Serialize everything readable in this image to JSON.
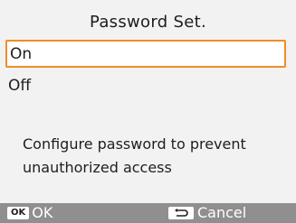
{
  "title": "Password Set.",
  "menu": {
    "items": [
      {
        "label": "On"
      },
      {
        "label": "Off"
      }
    ],
    "selected_color": "#f08c2a"
  },
  "description": "Configure password to prevent unauthorized access",
  "footer": {
    "ok_chip": "OK",
    "ok_label": "OK",
    "cancel_label": "Cancel",
    "back_icon": "return-arrow-icon"
  }
}
